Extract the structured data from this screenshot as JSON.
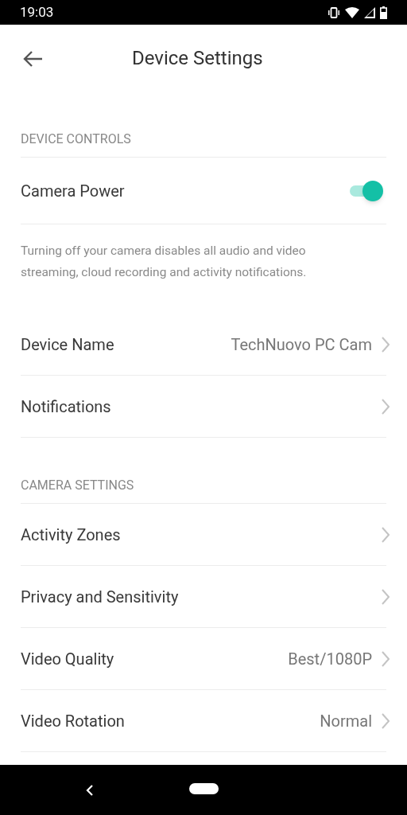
{
  "status_bar": {
    "time": "19:03"
  },
  "header": {
    "title": "Device Settings"
  },
  "sections": [
    {
      "header": "DEVICE CONTROLS",
      "items": [
        {
          "kind": "toggle",
          "label": "Camera Power",
          "on": true
        }
      ],
      "note": "Turning off your camera disables all audio and video streaming, cloud recording and activity notifications."
    },
    {
      "items": [
        {
          "kind": "link",
          "label": "Device Name",
          "value": "TechNuovo PC Cam"
        },
        {
          "kind": "link",
          "label": "Notifications"
        }
      ]
    },
    {
      "header": "CAMERA SETTINGS",
      "items": [
        {
          "kind": "link",
          "label": "Activity Zones"
        },
        {
          "kind": "link",
          "label": "Privacy and Sensitivity"
        },
        {
          "kind": "link",
          "label": "Video Quality",
          "value": "Best/1080P"
        },
        {
          "kind": "link",
          "label": "Video Rotation",
          "value": "Normal"
        }
      ]
    }
  ]
}
